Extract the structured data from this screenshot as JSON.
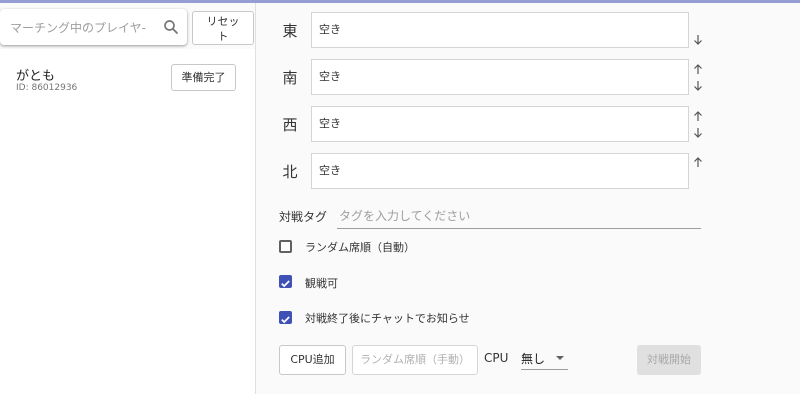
{
  "search": {
    "placeholder": "マーチング中のプレイヤ‑"
  },
  "reset_button": "リセッ\nト",
  "players": [
    {
      "name": "がとも",
      "id": "ID: 86012936",
      "ready_label": "準備完了"
    }
  ],
  "seats": [
    {
      "wind": "東",
      "value": "空き",
      "arrows": [
        "down"
      ]
    },
    {
      "wind": "南",
      "value": "空き",
      "arrows": [
        "up",
        "down"
      ]
    },
    {
      "wind": "西",
      "value": "空き",
      "arrows": [
        "up",
        "down"
      ]
    },
    {
      "wind": "北",
      "value": "空き",
      "arrows": [
        "up"
      ]
    }
  ],
  "tag": {
    "label": "対戦タグ",
    "placeholder": "タグを入力してください"
  },
  "options": [
    {
      "label": "ランダム席順（自動）",
      "checked": false
    },
    {
      "label": "観戦可",
      "checked": true
    },
    {
      "label": "対戦終了後にチャットでお知らせ",
      "checked": true
    }
  ],
  "actions": {
    "add_cpu": "CPU追加",
    "random_manual": "ランダム席順（手動）",
    "cpu_label": "CPU",
    "cpu_value": "無し",
    "start": "対戦開始"
  },
  "colors": {
    "accent": "#3f51b5",
    "disabled_bg": "#e0e0e0"
  }
}
